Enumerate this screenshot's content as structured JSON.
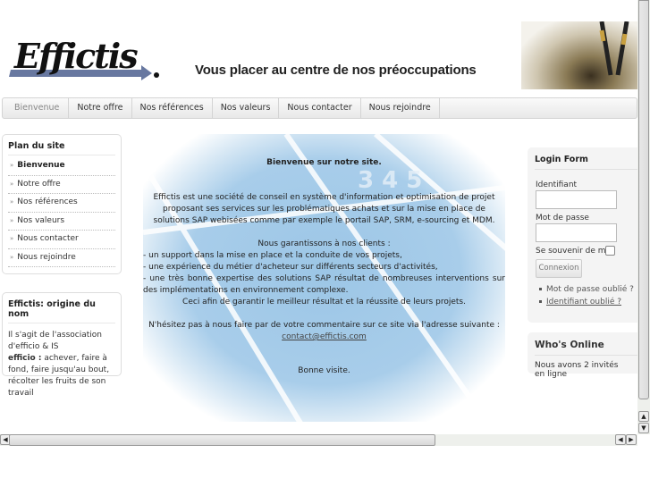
{
  "header": {
    "logo_text": "Effictis.",
    "tagline": "Vous placer au centre de nos préoccupations"
  },
  "nav": {
    "items": [
      "Bienvenue",
      "Notre offre",
      "Nos références",
      "Nos valeurs",
      "Nous contacter",
      "Nous rejoindre"
    ],
    "active": "Bienvenue"
  },
  "plan": {
    "title": "Plan du site",
    "items": [
      "Bienvenue",
      "Notre offre",
      "Nos références",
      "Nos valeurs",
      "Nous contacter",
      "Nous rejoindre"
    ]
  },
  "origin": {
    "title": "Effictis: origine du nom",
    "line1": "Il s'agit de l'association d'efficio & IS",
    "term": "efficio :",
    "definition": " achever, faire à fond, faire jusqu'au bout, récolter les fruits de son travail"
  },
  "content": {
    "heading": "Bienvenue sur notre site.",
    "intro": "Effictis est une société de conseil en système d'information et optimisation de projet proposant ses services sur les problématiques achats et sur la mise en place de solutions SAP webisées comme par exemple le portail SAP, SRM, e-sourcing et MDM.",
    "guarantee": "Nous garantissons à nos clients :",
    "bullets": [
      "- un support dans la mise en place et la conduite de vos projets,",
      "- une expérience du métier d'acheteur sur différents secteurs d'activités,",
      "- une très bonne expertise des solutions SAP résultat de nombreuses interventions sur des implémentations en environnement complexe."
    ],
    "goal": "Ceci afin de garantir le meilleur résultat et la réussite de leurs projets.",
    "contact_text": "N'hésitez pas à nous faire par de votre commentaire sur ce site via l'adresse suivante :",
    "email": "contact@effictis.com",
    "closing": "Bonne visite."
  },
  "login": {
    "title": "Login Form",
    "username_label": "Identifiant",
    "username_value": "",
    "password_label": "Mot de passe",
    "password_value": "",
    "remember_label": "Se souvenir de moi",
    "remember_checked": false,
    "submit": "Connexion",
    "forgot_password": "Mot de passe oublié ?",
    "forgot_username": "Identifiant oublié ?"
  },
  "who": {
    "title": "Who's Online",
    "text": "Nous avons 2 invités en ligne"
  },
  "colors": {
    "logo": "#5a6a8a",
    "nav_bg": "#eeeeee",
    "center_bg": "#a8cdea"
  },
  "icons": [
    "list-arrow-icon",
    "scroll-up-icon",
    "scroll-down-icon",
    "scroll-left-icon",
    "scroll-right-icon"
  ]
}
